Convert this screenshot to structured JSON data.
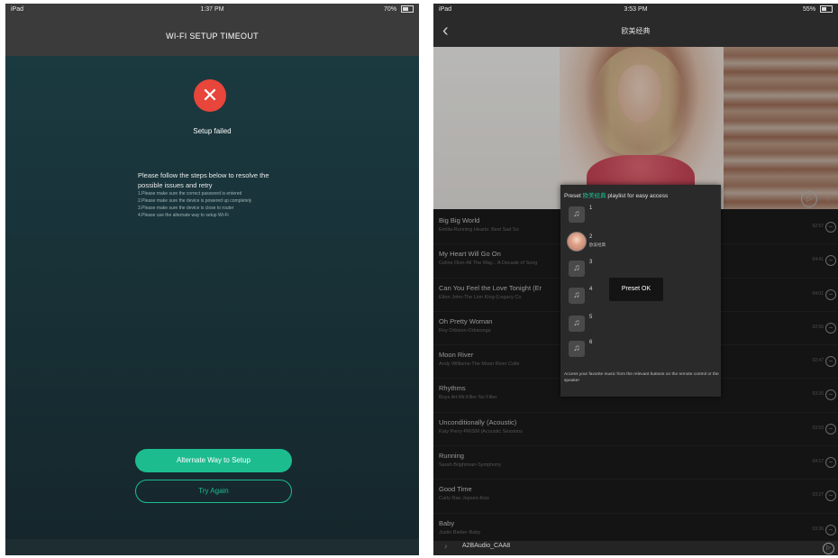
{
  "left": {
    "status": {
      "carrier": "iPad",
      "time": "1:37 PM",
      "battery": "70%"
    },
    "title": "WI-FI SETUP TIMEOUT",
    "fail_icon": "close-x-icon",
    "fail_text": "Setup failed",
    "instructions": {
      "heading": "Please follow the steps below to resolve the possible issues and retry",
      "steps": [
        "1.Please make sure the correct password is entered",
        "2.Please make sure the device is powered up completely",
        "3.Please make sure the device is close to router",
        "4.Please use the alternate way to setup Wi-Fi"
      ]
    },
    "primary_button": "Alternate Way to Setup",
    "secondary_button": "Try Again"
  },
  "right": {
    "status": {
      "carrier": "iPad",
      "time": "3:53 PM",
      "battery": "55%"
    },
    "nav_title": "欧美经典",
    "songs": [
      {
        "title": "Big Big World",
        "subtitle": "Emilia-Running Hearts: Best Sad So",
        "duration": "02:57"
      },
      {
        "title": "My Heart Will Go On",
        "subtitle": "Celine Dion-All The Way... A Decade of Song",
        "duration": "04:41"
      },
      {
        "title": "Can You Feel the Love Tonight (Er",
        "subtitle": "Elton John-The Lion King (Legacy Co",
        "duration": "04:01"
      },
      {
        "title": "Oh Pretty Woman",
        "subtitle": "Roy Orbison-Orbisongs",
        "duration": "02:56"
      },
      {
        "title": "Moon River",
        "subtitle": "Andy Williams-The Moon River Colle",
        "duration": "02:47"
      },
      {
        "title": "Rhythms",
        "subtitle": "Boys Art-Mr.Killer Nu Filter",
        "duration": "03:26"
      },
      {
        "title": "Unconditionally (Acoustic)",
        "subtitle": "Katy Perry-PRISM (Acoustic Sessions",
        "duration": "03:53"
      },
      {
        "title": "Running",
        "subtitle": "Sarah Brightman-Symphony",
        "duration": "04:17"
      },
      {
        "title": "Good Time",
        "subtitle": "Carly Rae Jepsen-Kiss",
        "duration": "03:27"
      },
      {
        "title": "Baby",
        "subtitle": "Justin Bieber-Baby",
        "duration": "03:36"
      }
    ],
    "preset_popup": {
      "head_before": "Preset ",
      "head_highlight": "欧美经典",
      "head_after": " playlist for easy access",
      "items": [
        {
          "num": "1",
          "name": ""
        },
        {
          "num": "2",
          "name": "欧美经典"
        },
        {
          "num": "3",
          "name": ""
        },
        {
          "num": "4",
          "name": ""
        },
        {
          "num": "5",
          "name": ""
        },
        {
          "num": "6",
          "name": ""
        }
      ],
      "footer": "Access your favorite music from the relevant buttons on the remote control or the speaker"
    },
    "toast": "Preset OK",
    "player": {
      "title": "A2BAudio_CAA8"
    },
    "colors": {
      "accent": "#1dbc8f",
      "error": "#e8453b"
    }
  }
}
